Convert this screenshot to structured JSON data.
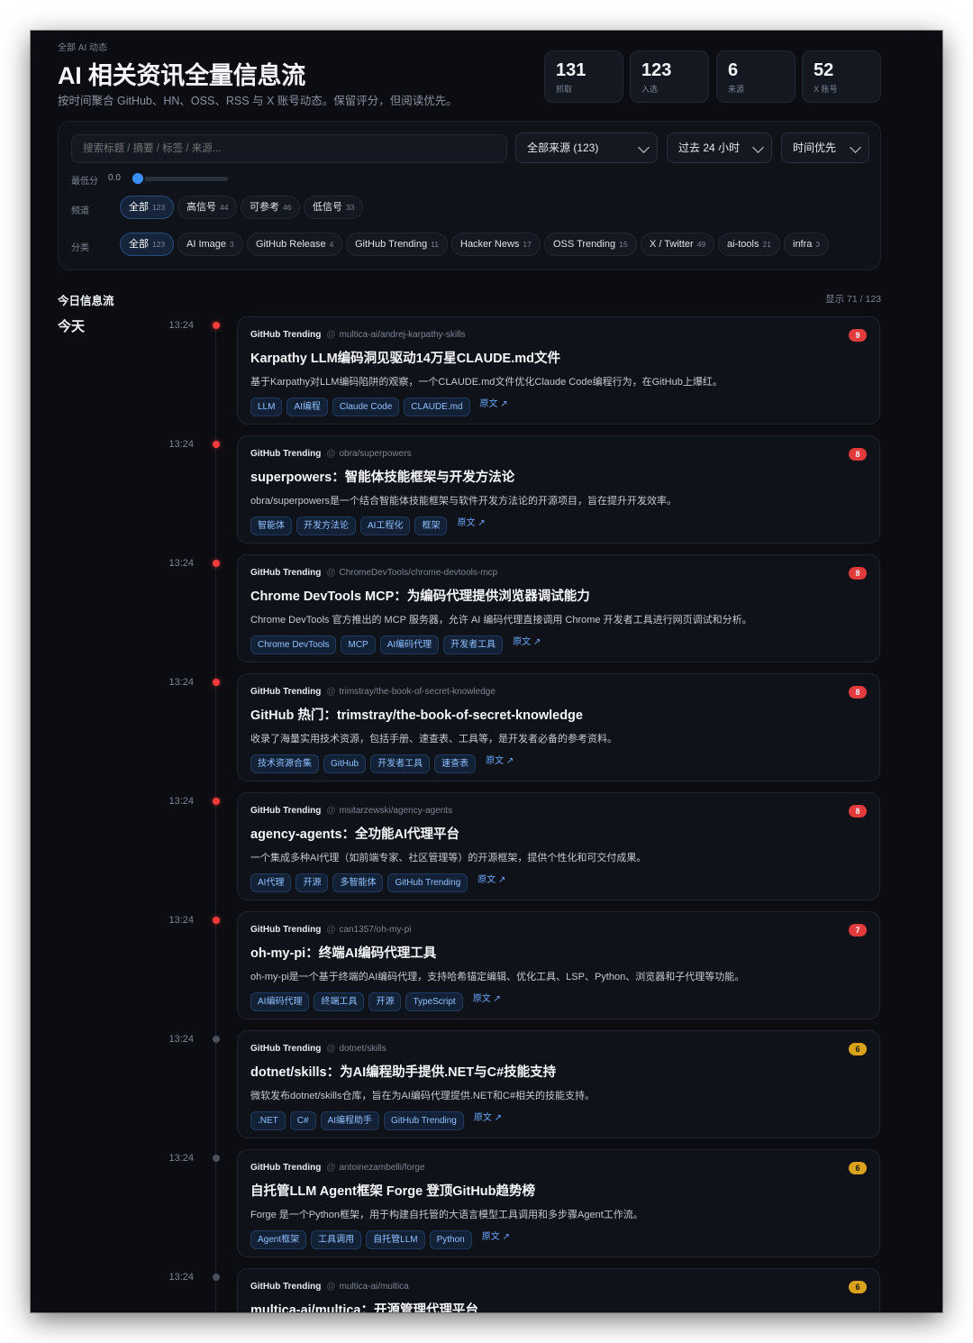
{
  "header": {
    "kicker": "全部 AI 动态",
    "title": "AI 相关资讯全量信息流",
    "subtitle": "按时间聚合 GitHub、HN、OSS、RSS 与 X 账号动态。保留评分，但阅读优先。"
  },
  "stats": [
    {
      "num": "131",
      "label": "抓取"
    },
    {
      "num": "123",
      "label": "入选"
    },
    {
      "num": "6",
      "label": "来源"
    },
    {
      "num": "52",
      "label": "X 账号"
    }
  ],
  "filters": {
    "search_placeholder": "搜索标题 / 摘要 / 标签 / 来源...",
    "source_select": "全部来源 (123)",
    "time_select": "过去 24 小时",
    "sort_select": "时间优先",
    "min_score_label": "最低分",
    "min_score_value": "0.0",
    "min_score_fraction": 0.0,
    "channel_label": "频道",
    "category_label": "分类",
    "channels": [
      {
        "name": "全部",
        "count": "123",
        "active": true
      },
      {
        "name": "高信号",
        "count": "44",
        "active": false
      },
      {
        "name": "可参考",
        "count": "46",
        "active": false
      },
      {
        "name": "低信号",
        "count": "33",
        "active": false
      }
    ],
    "categories": [
      {
        "name": "全部",
        "count": "123",
        "active": true
      },
      {
        "name": "AI Image",
        "count": "3",
        "active": false
      },
      {
        "name": "GitHub Release",
        "count": "4",
        "active": false
      },
      {
        "name": "GitHub Trending",
        "count": "11",
        "active": false
      },
      {
        "name": "Hacker News",
        "count": "17",
        "active": false
      },
      {
        "name": "OSS Trending",
        "count": "15",
        "active": false
      },
      {
        "name": "X / Twitter",
        "count": "49",
        "active": false
      },
      {
        "name": "ai-tools",
        "count": "21",
        "active": false
      },
      {
        "name": "infra",
        "count": "3",
        "active": false
      }
    ]
  },
  "feed": {
    "title": "今日信息流",
    "count_text": "显示 71 / 123",
    "day_label": "今天",
    "items": [
      {
        "time": "13:24",
        "hot": true,
        "source": "GitHub Trending",
        "repo": "multica-ai/andrej-karpathy-skills",
        "title": "Karpathy LLM编码洞见驱动14万星CLAUDE.md文件",
        "summary": "基于Karpathy对LLM编码陷阱的观察，一个CLAUDE.md文件优化Claude Code编程行为，在GitHub上爆红。",
        "tags": [
          "LLM",
          "AI编程",
          "Claude Code",
          "CLAUDE.md"
        ],
        "link": "原文 ↗",
        "score": "9",
        "score_color": "#e23b3b"
      },
      {
        "time": "13:24",
        "hot": true,
        "source": "GitHub Trending",
        "repo": "obra/superpowers",
        "title": "superpowers：智能体技能框架与开发方法论",
        "summary": "obra/superpowers是一个结合智能体技能框架与软件开发方法论的开源项目，旨在提升开发效率。",
        "tags": [
          "智能体",
          "开发方法论",
          "AI工程化",
          "框架"
        ],
        "link": "原文 ↗",
        "score": "8",
        "score_color": "#e23b3b"
      },
      {
        "time": "13:24",
        "hot": true,
        "source": "GitHub Trending",
        "repo": "ChromeDevTools/chrome-devtools-mcp",
        "title": "Chrome DevTools MCP：为编码代理提供浏览器调试能力",
        "summary": "Chrome DevTools 官方推出的 MCP 服务器，允许 AI 编码代理直接调用 Chrome 开发者工具进行网页调试和分析。",
        "tags": [
          "Chrome DevTools",
          "MCP",
          "AI编码代理",
          "开发者工具"
        ],
        "link": "原文 ↗",
        "score": "8",
        "score_color": "#e23b3b"
      },
      {
        "time": "13:24",
        "hot": true,
        "source": "GitHub Trending",
        "repo": "trimstray/the-book-of-secret-knowledge",
        "title": "GitHub 热门：trimstray/the-book-of-secret-knowledge",
        "summary": "收录了海量实用技术资源，包括手册、速查表、工具等，是开发者必备的参考资料。",
        "tags": [
          "技术资源合集",
          "GitHub",
          "开发者工具",
          "速查表"
        ],
        "link": "原文 ↗",
        "score": "8",
        "score_color": "#e23b3b"
      },
      {
        "time": "13:24",
        "hot": true,
        "source": "GitHub Trending",
        "repo": "msitarzewski/agency-agents",
        "title": "agency-agents：全功能AI代理平台",
        "summary": "一个集成多种AI代理（如前端专家、社区管理等）的开源框架，提供个性化和可交付成果。",
        "tags": [
          "AI代理",
          "开源",
          "多智能体",
          "GitHub Trending"
        ],
        "link": "原文 ↗",
        "score": "8",
        "score_color": "#e23b3b"
      },
      {
        "time": "13:24",
        "hot": true,
        "source": "GitHub Trending",
        "repo": "can1357/oh-my-pi",
        "title": "oh-my-pi：终端AI编码代理工具",
        "summary": "oh-my-pi是一个基于终端的AI编码代理，支持哈希锚定编辑、优化工具、LSP、Python、浏览器和子代理等功能。",
        "tags": [
          "AI编码代理",
          "终端工具",
          "开源",
          "TypeScript"
        ],
        "link": "原文 ↗",
        "score": "7",
        "score_color": "#e23b3b"
      },
      {
        "time": "13:24",
        "hot": false,
        "source": "GitHub Trending",
        "repo": "dotnet/skills",
        "title": "dotnet/skills：为AI编程助手提供.NET与C#技能支持",
        "summary": "微软发布dotnet/skills仓库，旨在为AI编码代理提供.NET和C#相关的技能支持。",
        "tags": [
          ".NET",
          "C#",
          "AI编程助手",
          "GitHub Trending"
        ],
        "link": "原文 ↗",
        "score": "6",
        "score_color": "#d9a21b"
      },
      {
        "time": "13:24",
        "hot": false,
        "source": "GitHub Trending",
        "repo": "antoinezambelli/forge",
        "title": "自托管LLM Agent框架 Forge 登顶GitHub趋势榜",
        "summary": "Forge 是一个Python框架，用于构建自托管的大语言模型工具调用和多步骤Agent工作流。",
        "tags": [
          "Agent框架",
          "工具调用",
          "自托管LLM",
          "Python"
        ],
        "link": "原文 ↗",
        "score": "6",
        "score_color": "#d9a21b"
      },
      {
        "time": "13:24",
        "hot": false,
        "source": "GitHub Trending",
        "repo": "multica-ai/multica",
        "title": "multica-ai/multica：开源管理代理平台",
        "summary": "",
        "tags": [],
        "link": "",
        "score": "6",
        "score_color": "#d9a21b"
      }
    ]
  }
}
